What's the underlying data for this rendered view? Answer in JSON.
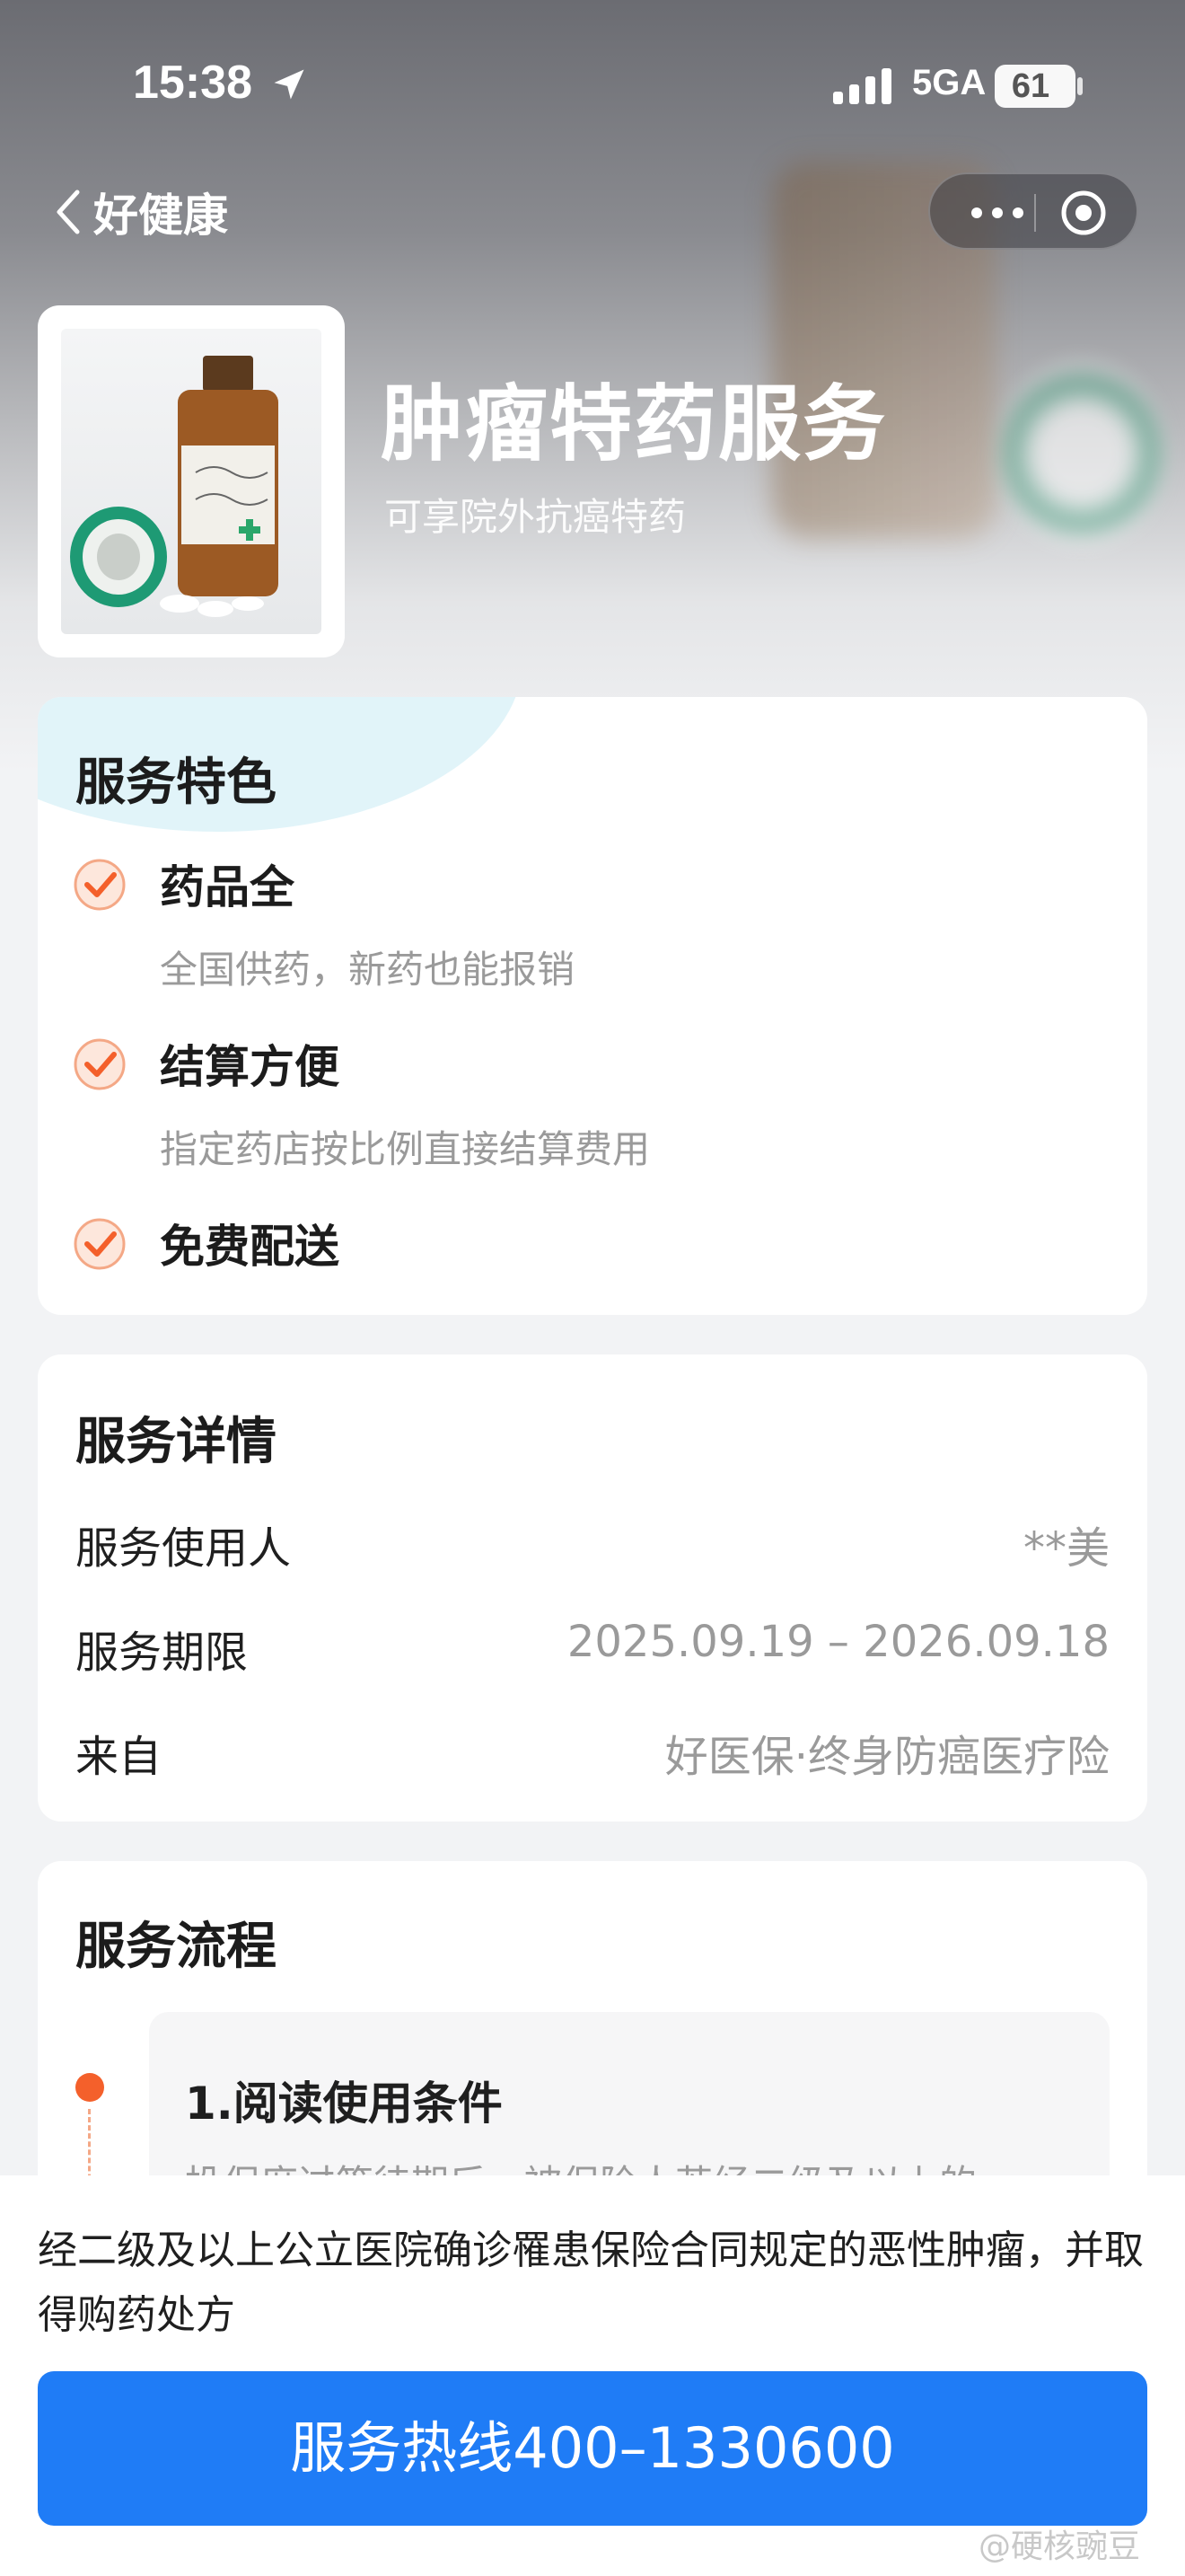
{
  "status_bar": {
    "time": "15:38",
    "network": "5GA",
    "battery": "61"
  },
  "nav": {
    "back_label": "好健康",
    "more_icon": "more-dots-icon",
    "close_icon": "target-circle-icon"
  },
  "service": {
    "title": "肿瘤特药服务",
    "subtitle": "可享院外抗癌特药"
  },
  "features": {
    "title": "服务特色",
    "items": [
      {
        "title": "药品全",
        "desc": "全国供药，新药也能报销"
      },
      {
        "title": "结算方便",
        "desc": "指定药店按比例直接结算费用"
      },
      {
        "title": "免费配送",
        "desc": ""
      }
    ],
    "accent": "#f4602b"
  },
  "details": {
    "title": "服务详情",
    "rows": [
      {
        "label": "服务使用人",
        "value": "**美"
      },
      {
        "label": "服务期限",
        "value": "2025.09.19 – 2026.09.18"
      },
      {
        "label": "来自",
        "value": "好医保·终身防癌医疗险"
      }
    ]
  },
  "process": {
    "title": "服务流程",
    "steps": [
      {
        "title": "1.阅读使用条件",
        "desc": "投保度过等待期后，被保险人若经二级及以上的"
      }
    ]
  },
  "bottom": {
    "condition_text": "经二级及以上公立医院确诊罹患保险合同规定的恶性肿瘤，并取得购药处方",
    "hotline_label": "服务热线400–1330600",
    "button_color": "#1f7cf6"
  },
  "watermark": "@硬核豌豆"
}
